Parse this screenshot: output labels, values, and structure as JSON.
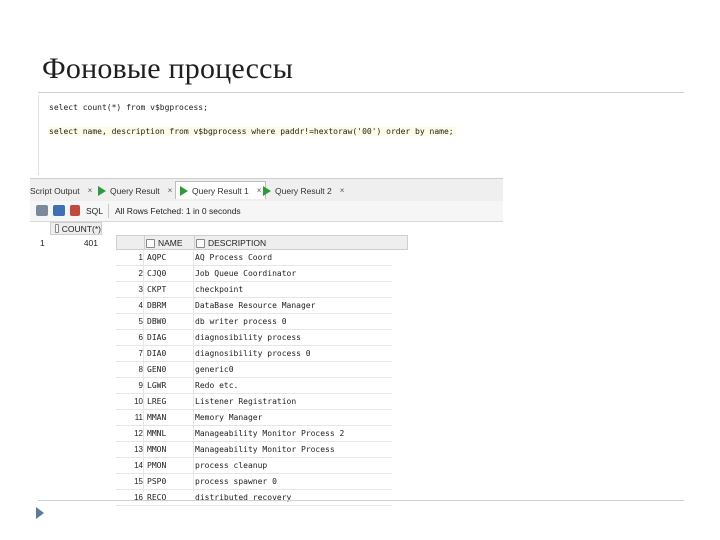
{
  "slide": {
    "title": "Фоновые процессы"
  },
  "editor": {
    "sql_lines": [
      "select count(*) from v$bgprocess;",
      "select name, description from v$bgprocess where paddr!=hextoraw('00') order by name;"
    ]
  },
  "tabs": [
    {
      "label": "Script Output",
      "icon": "",
      "active": false
    },
    {
      "label": "Query Result",
      "icon": "play-icon",
      "active": false
    },
    {
      "label": "Query Result 1",
      "icon": "play-icon",
      "active": true
    },
    {
      "label": "Query Result 2",
      "icon": "play-icon",
      "active": false
    }
  ],
  "tab_close": "×",
  "toolbar": {
    "sql_label": "SQL",
    "status": "All Rows Fetched: 1 in 0 seconds"
  },
  "count_result": {
    "column": "COUNT(*)",
    "rownum": "1",
    "value": "401"
  },
  "result": {
    "columns": [
      "NAME",
      "DESCRIPTION"
    ],
    "rows": [
      {
        "num": "1",
        "name": "AQPC",
        "description": "AQ Process Coord"
      },
      {
        "num": "2",
        "name": "CJQ0",
        "description": "Job Queue Coordinator"
      },
      {
        "num": "3",
        "name": "CKPT",
        "description": "checkpoint"
      },
      {
        "num": "4",
        "name": "DBRM",
        "description": "DataBase Resource Manager"
      },
      {
        "num": "5",
        "name": "DBW0",
        "description": "db writer process 0"
      },
      {
        "num": "6",
        "name": "DIAG",
        "description": "diagnosibility process"
      },
      {
        "num": "7",
        "name": "DIA0",
        "description": "diagnosibility process 0"
      },
      {
        "num": "8",
        "name": "GEN0",
        "description": "generic0"
      },
      {
        "num": "9",
        "name": "LGWR",
        "description": "Redo etc."
      },
      {
        "num": "10",
        "name": "LREG",
        "description": "Listener Registration"
      },
      {
        "num": "11",
        "name": "MMAN",
        "description": "Memory Manager"
      },
      {
        "num": "12",
        "name": "MMNL",
        "description": "Manageability Monitor Process 2"
      },
      {
        "num": "13",
        "name": "MMON",
        "description": "Manageability Monitor Process"
      },
      {
        "num": "14",
        "name": "PMON",
        "description": "process cleanup"
      },
      {
        "num": "15",
        "name": "PSP0",
        "description": "process spawner 0"
      },
      {
        "num": "16",
        "name": "RECO",
        "description": "distributed recovery"
      }
    ]
  },
  "colors": {
    "play": "#2e9a3a",
    "bullet": "#5b7c99",
    "keyword": "#1b3da8"
  }
}
